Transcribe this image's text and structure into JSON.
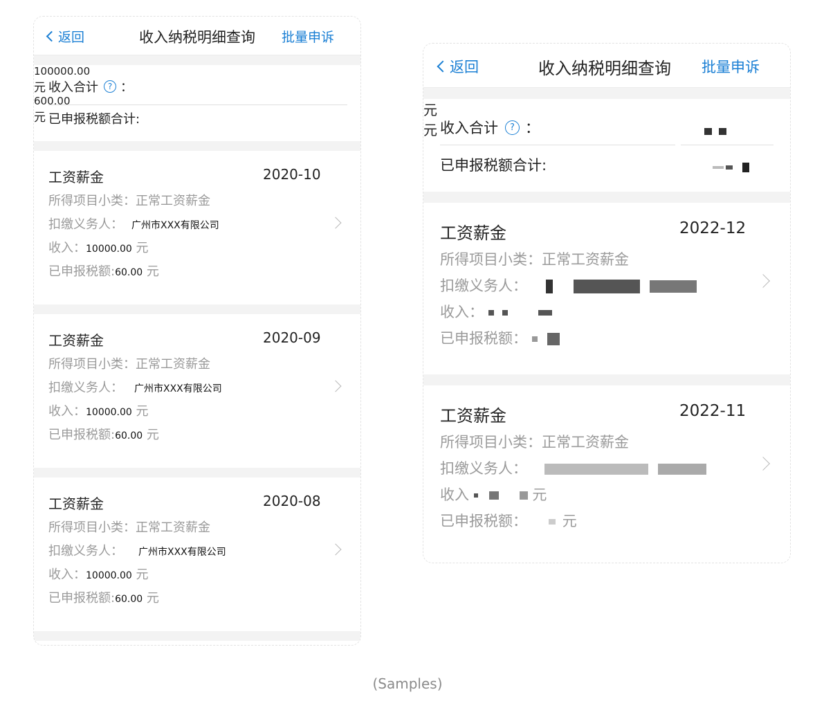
{
  "left": {
    "nav": {
      "back_label": "返回",
      "title": "收入纳税明细查询",
      "action_label": "批量申诉"
    },
    "summary": {
      "income_label": "收入合计",
      "colon": "：",
      "help_glyph": "?",
      "income_value": "100000.00",
      "income_unit": "元",
      "tax_label": "已申报税额合计:",
      "tax_value": "600.00",
      "tax_unit": "元"
    },
    "records": [
      {
        "title": "工资薪金",
        "date": "2020-10",
        "subcategory_label": "所得项目小类：",
        "subcategory_value": "正常工资薪金",
        "withholder_label": "扣缴义务人：",
        "withholder_value": "广州市XXX有限公司",
        "income_label": "收入：",
        "income_value": "10000.00",
        "income_unit": "元",
        "tax_label": "已申报税额:",
        "tax_value": "60.00",
        "tax_unit": "元"
      },
      {
        "title": "工资薪金",
        "date": "2020-09",
        "subcategory_label": "所得项目小类：",
        "subcategory_value": "正常工资薪金",
        "withholder_label": "扣缴义务人：",
        "withholder_value": "广州市XXX有限公司",
        "income_label": "收入：",
        "income_value": "10000.00",
        "income_unit": "元",
        "tax_label": "已申报税额:",
        "tax_value": "60.00",
        "tax_unit": "元"
      },
      {
        "title": "工资薪金",
        "date": "2020-08",
        "subcategory_label": "所得项目小类：",
        "subcategory_value": "正常工资薪金",
        "withholder_label": "扣缴义务人：",
        "withholder_value": "广州市XXX有限公司",
        "income_label": "收入：",
        "income_value": "10000.00",
        "income_unit": "元",
        "tax_label": "已申报税额:",
        "tax_value": "60.00",
        "tax_unit": "元"
      }
    ]
  },
  "right": {
    "nav": {
      "back_label": "返回",
      "title": "收入纳税明细查询",
      "action_label": "批量申诉"
    },
    "summary": {
      "income_label": "收入合计",
      "colon": "：",
      "help_glyph": "?",
      "income_unit": "元",
      "tax_label": "已申报税额合计:",
      "tax_unit": "元"
    },
    "records": [
      {
        "title": "工资薪金",
        "date": "2022-12",
        "subcategory_label": "所得项目小类：",
        "subcategory_value": "正常工资薪金",
        "withholder_label": "扣缴义务人：",
        "income_label": "收入：",
        "tax_label": "已申报税额："
      },
      {
        "title": "工资薪金",
        "date": "2022-11",
        "subcategory_label": "所得项目小类：",
        "subcategory_value": "正常工资薪金",
        "withholder_label": "扣缴义务人：",
        "income_label": "收入",
        "income_unit": "元",
        "tax_label": "已申报税额：",
        "tax_unit": "元"
      }
    ]
  },
  "caption": "(Samples)",
  "colors": {
    "accent": "#1a7fd4",
    "muted_text": "#9a9a9a",
    "band": "#f3f3f3"
  }
}
